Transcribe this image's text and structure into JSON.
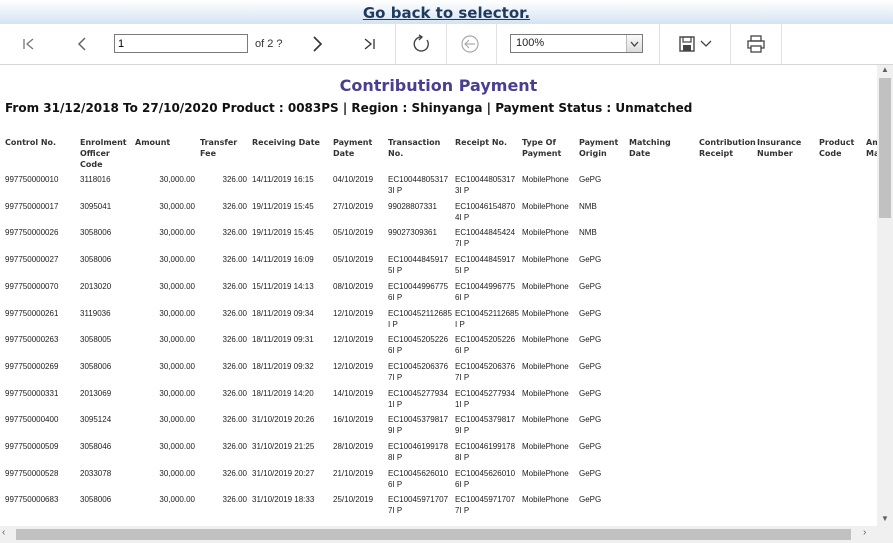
{
  "topbar": {
    "link": "Go back to selector."
  },
  "toolbar": {
    "page_value": "1",
    "page_of": "of 2 ?",
    "zoom_value": "100%"
  },
  "report": {
    "title": "Contribution Payment",
    "subtitle": "From 31/12/2018 To 27/10/2020 Product : 0083PS | Region : Shinyanga | Payment Status : Unmatched",
    "columns": [
      "Control No.",
      "Enrolment Officer Code",
      "Amount",
      "Transfer Fee",
      "Receiving Date",
      "Payment Date",
      "Transaction No.",
      "Receipt No.",
      "Type Of Payment",
      "Payment Origin",
      "Matching Date",
      "Contribution Receipt",
      "Insurance Number",
      "Product Code",
      "Am Ma"
    ],
    "rows": [
      [
        "997750000010",
        "3118016",
        "30,000.00",
        "326.00",
        "14/11/2019 16:15",
        "04/10/2019",
        "EC100448053173I P",
        "EC100448053173I P",
        "MobilePhone",
        "GePG"
      ],
      [
        "997750000017",
        "3095041",
        "30,000.00",
        "326.00",
        "19/11/2019 15:45",
        "27/10/2019",
        "99028807331",
        "EC100461548704I P",
        "MobilePhone",
        "NMB"
      ],
      [
        "997750000026",
        "3058006",
        "30,000.00",
        "326.00",
        "19/11/2019 15:45",
        "05/10/2019",
        "99027309361",
        "EC100448454247I P",
        "MobilePhone",
        "NMB"
      ],
      [
        "997750000027",
        "3058006",
        "30,000.00",
        "326.00",
        "14/11/2019 16:09",
        "05/10/2019",
        "EC100448459175I P",
        "EC100448459175I P",
        "MobilePhone",
        "GePG"
      ],
      [
        "997750000070",
        "2013020",
        "30,000.00",
        "326.00",
        "15/11/2019 14:13",
        "08/10/2019",
        "EC100449967756I P",
        "EC100449967756I P",
        "MobilePhone",
        "GePG"
      ],
      [
        "997750000261",
        "3119036",
        "30,000.00",
        "326.00",
        "18/11/2019 09:34",
        "12/10/2019",
        "EC100452112685I P",
        "EC100452112685I P",
        "MobilePhone",
        "GePG"
      ],
      [
        "997750000263",
        "3058005",
        "30,000.00",
        "326.00",
        "18/11/2019 09:31",
        "12/10/2019",
        "EC100452052266I P",
        "EC100452052266I P",
        "MobilePhone",
        "GePG"
      ],
      [
        "997750000269",
        "3058006",
        "30,000.00",
        "326.00",
        "18/11/2019 09:32",
        "12/10/2019",
        "EC100452063767I P",
        "EC100452063767I P",
        "MobilePhone",
        "GePG"
      ],
      [
        "997750000331",
        "2013069",
        "30,000.00",
        "326.00",
        "18/11/2019 14:20",
        "14/10/2019",
        "EC100452779341I P",
        "EC100452779341I P",
        "MobilePhone",
        "GePG"
      ],
      [
        "997750000400",
        "3095124",
        "30,000.00",
        "326.00",
        "31/10/2019 20:26",
        "16/10/2019",
        "EC100453798179I P",
        "EC100453798179I P",
        "MobilePhone",
        "GePG"
      ],
      [
        "997750000509",
        "3058046",
        "30,000.00",
        "326.00",
        "31/10/2019 21:25",
        "28/10/2019",
        "EC100461991788I P",
        "EC100461991788I P",
        "MobilePhone",
        "GePG"
      ],
      [
        "997750000528",
        "2033078",
        "30,000.00",
        "326.00",
        "31/10/2019 20:27",
        "21/10/2019",
        "EC100456260106I P",
        "EC100456260106I P",
        "MobilePhone",
        "GePG"
      ],
      [
        "997750000683",
        "3058006",
        "30,000.00",
        "326.00",
        "31/10/2019 18:33",
        "25/10/2019",
        "EC100459717077I P",
        "EC100459717077I P",
        "MobilePhone",
        "GePG"
      ]
    ]
  }
}
